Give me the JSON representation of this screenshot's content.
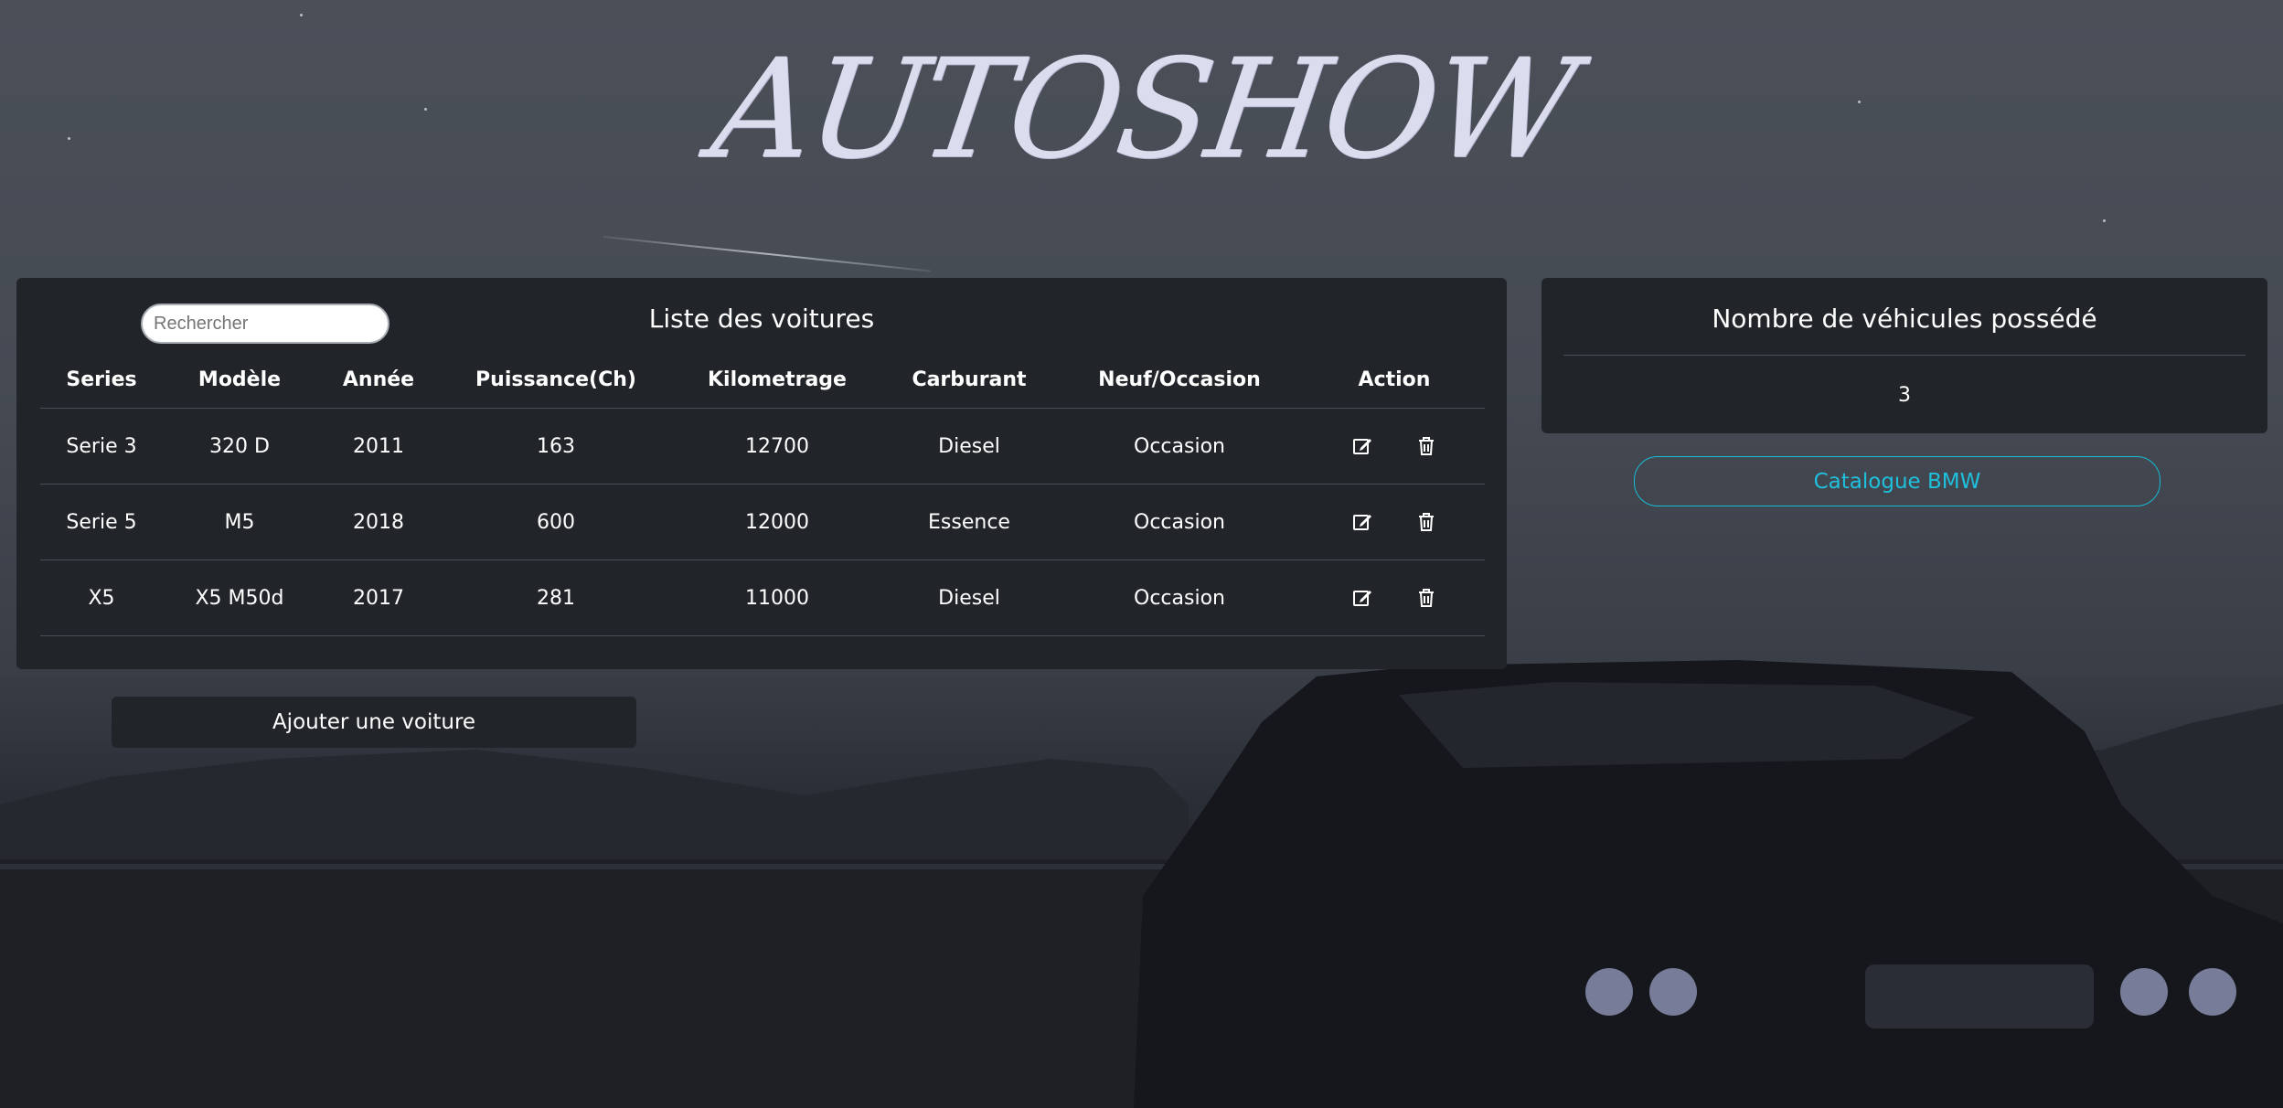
{
  "logo": {
    "text": "AUTOSHOW"
  },
  "cars_panel": {
    "title": "Liste des voitures",
    "search_placeholder": "Rechercher",
    "columns": [
      "Series",
      "Modèle",
      "Année",
      "Puissance(Ch)",
      "Kilometrage",
      "Carburant",
      "Neuf/Occasion",
      "Action"
    ],
    "rows": [
      [
        "Serie 3",
        "320 D",
        "2011",
        "163",
        "12700",
        "Diesel",
        "Occasion"
      ],
      [
        "Serie 5",
        "M5",
        "2018",
        "600",
        "12000",
        "Essence",
        "Occasion"
      ],
      [
        "X5",
        "X5 M50d",
        "2017",
        "281",
        "11000",
        "Diesel",
        "Occasion"
      ]
    ],
    "row_icons": [
      "edit-icon",
      "trash-icon"
    ]
  },
  "add_button": {
    "label": "Ajouter une voiture"
  },
  "count_panel": {
    "title": "Nombre de véhicules possédé",
    "value": "3"
  },
  "catalogue_button": {
    "label": "Catalogue BMW"
  },
  "colors": {
    "panel_bg": "#212529",
    "accent": "#1fc0dc",
    "logo": "#dcdcef"
  }
}
